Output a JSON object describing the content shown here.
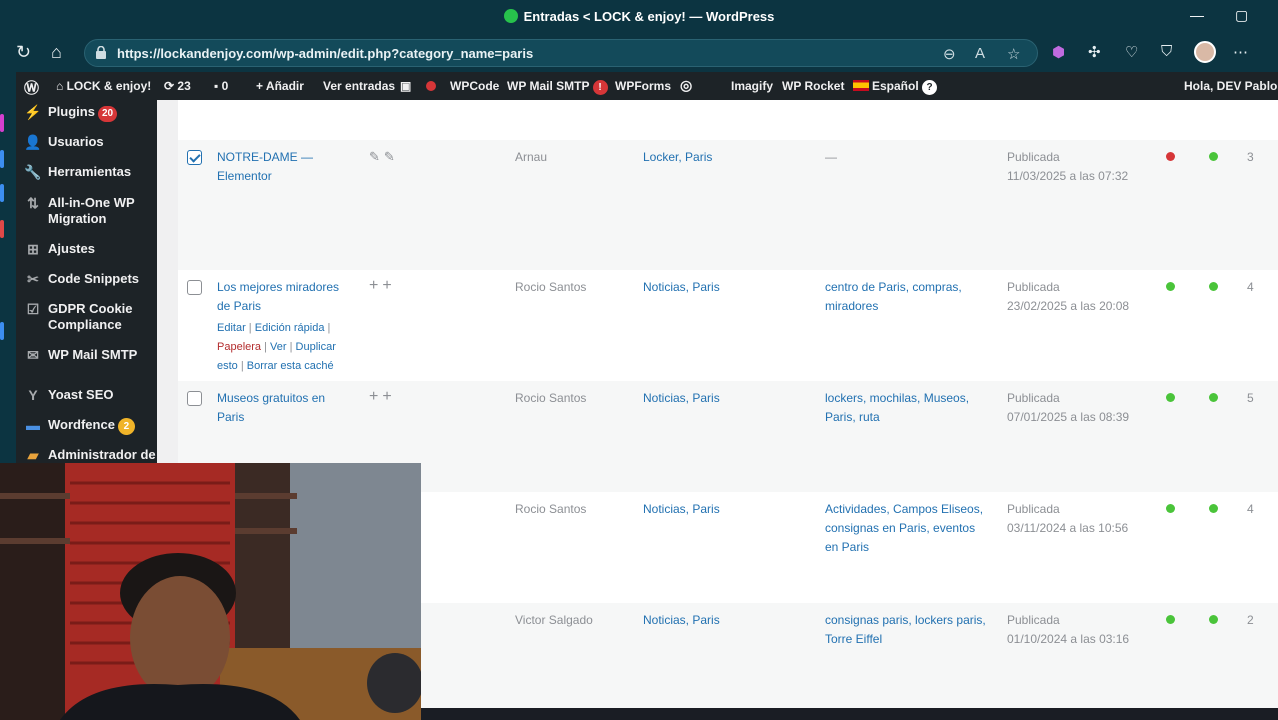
{
  "browser": {
    "tab_title": "Entradas < LOCK & enjoy! — WordPress",
    "url": "https://lockandenjoy.com/wp-admin/edit.php?category_name=paris"
  },
  "adminbar": {
    "site_name": "LOCK & enjoy!",
    "updates": "23",
    "comments": "0",
    "add": "Añadir",
    "view_posts": "Ver entradas",
    "wpcode": "WPCode",
    "wp_mail_smtp": "WP Mail SMTP",
    "wp_mail_smtp_badge": "!",
    "wpforms": "WPForms",
    "imagify": "Imagify",
    "wp_rocket": "WP Rocket",
    "language": "Español",
    "language_badge": "?",
    "greeting": "Hola, DEV Pablo"
  },
  "sidebar": {
    "items": [
      {
        "label": "Plugins",
        "count": "20",
        "icon": "plug-icon"
      },
      {
        "label": "Usuarios",
        "icon": "user-icon"
      },
      {
        "label": "Herramientas",
        "icon": "wrench-icon"
      },
      {
        "label": "All-in-One WP Migration",
        "icon": "migration-icon"
      },
      {
        "label": "Ajustes",
        "icon": "settings-icon"
      },
      {
        "label": "Code Snippets",
        "icon": "code-icon"
      },
      {
        "label": "GDPR Cookie Compliance",
        "icon": "cookie-icon"
      },
      {
        "label": "WP Mail SMTP",
        "icon": "mail-icon"
      },
      {
        "label": "Yoast SEO",
        "icon": "yoast-icon"
      },
      {
        "label": "Wordfence",
        "count": "2",
        "icon": "wordfence-icon"
      },
      {
        "label": "Administrador de",
        "icon": "folder-icon"
      }
    ]
  },
  "posts": [
    {
      "title": "NOTRE-DAME — Elementor",
      "author": "Arnau",
      "categories": "Locker, Paris",
      "tags": "—",
      "status": "Publicada",
      "date": "11/03/2025 a las 07:32",
      "comments": "3",
      "checked": true
    },
    {
      "title": "Los mejores miradores de Paris",
      "author": "Rocio Santos",
      "categories": "Noticias, Paris",
      "tags": "centro de Paris, compras, miradores",
      "status": "Publicada",
      "date": "23/02/2025 a las 20:08",
      "comments": "4",
      "actions": {
        "edit": "Editar",
        "quick_edit": "Edición rápida",
        "trash": "Papelera",
        "view": "Ver",
        "duplicate": "Duplicar esto",
        "clear_cache": "Borrar esta caché"
      }
    },
    {
      "title": "Museos gratuitos en Paris",
      "author": "Rocio Santos",
      "categories": "Noticias, Paris",
      "tags": "lockers, mochilas, Museos, Paris, ruta",
      "status": "Publicada",
      "date": "07/01/2025 a las 08:39",
      "comments": "5"
    },
    {
      "author": "Rocio Santos",
      "categories": "Noticias, Paris",
      "tags": "Actividades, Campos Eliseos, consignas en Paris, eventos en Paris",
      "status": "Publicada",
      "date": "03/11/2024 a las 10:56",
      "comments": "4"
    },
    {
      "author": "Victor Salgado",
      "categories": "Noticias, Paris",
      "tags": "consignas paris, lockers paris, Torre Eiffel",
      "status": "Publicada",
      "date": "01/10/2024 a las 03:16",
      "comments": "2"
    }
  ],
  "colors": {
    "accent": "#2271b1",
    "admin_bar": "#1d2327",
    "seo_good": "#4ac43a",
    "seo_bad": "#d63638"
  }
}
